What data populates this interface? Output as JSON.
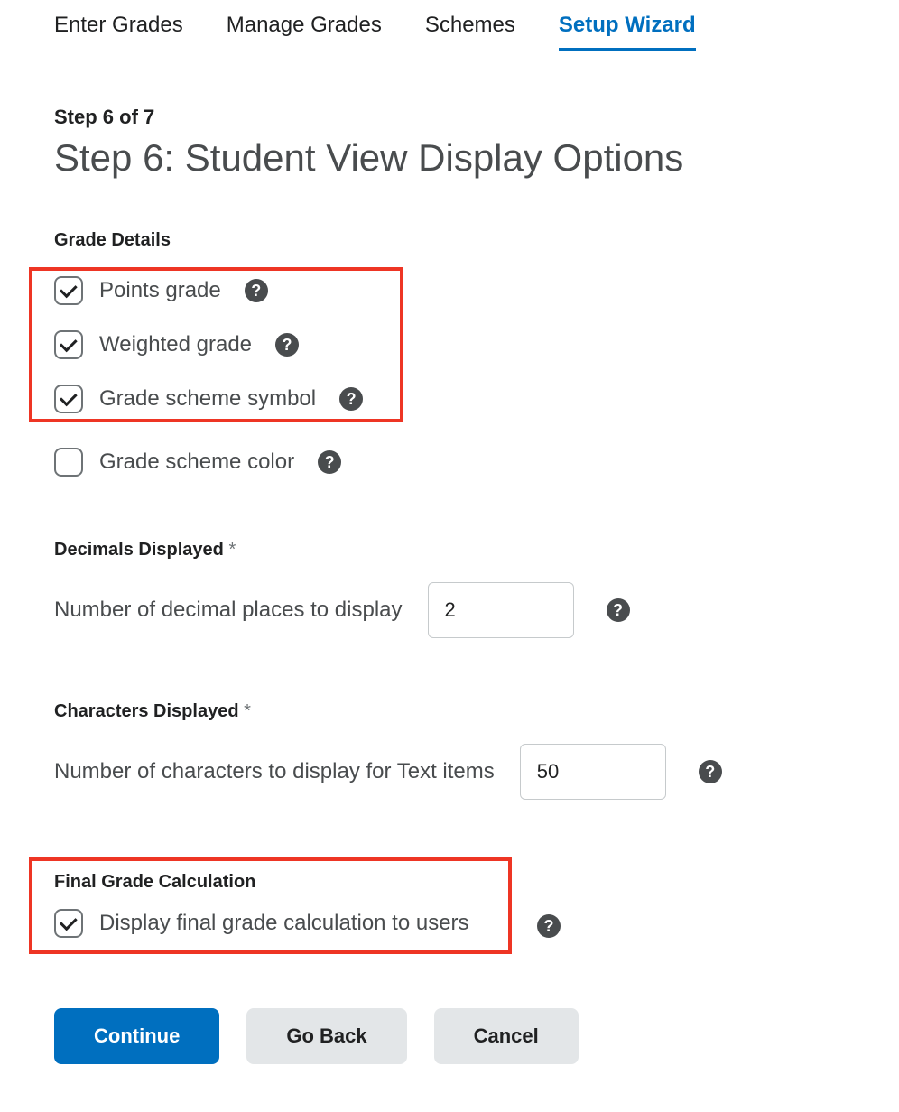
{
  "tabs": {
    "enter_grades": "Enter Grades",
    "manage_grades": "Manage Grades",
    "schemes": "Schemes",
    "setup_wizard": "Setup Wizard"
  },
  "step_counter": "Step 6 of 7",
  "step_title": "Step 6: Student View Display Options",
  "grade_details": {
    "heading": "Grade Details",
    "points_grade": "Points grade",
    "weighted_grade": "Weighted grade",
    "grade_scheme_symbol": "Grade scheme symbol",
    "grade_scheme_color": "Grade scheme color"
  },
  "decimals": {
    "heading": "Decimals Displayed",
    "label": "Number of decimal places to display",
    "value": "2"
  },
  "characters": {
    "heading": "Characters Displayed",
    "label": "Number of characters to display for Text items",
    "value": "50"
  },
  "final_grade": {
    "heading": "Final Grade Calculation",
    "label": "Display final grade calculation to users"
  },
  "buttons": {
    "continue": "Continue",
    "go_back": "Go Back",
    "cancel": "Cancel"
  },
  "required_marker": "*",
  "help_glyph": "?"
}
